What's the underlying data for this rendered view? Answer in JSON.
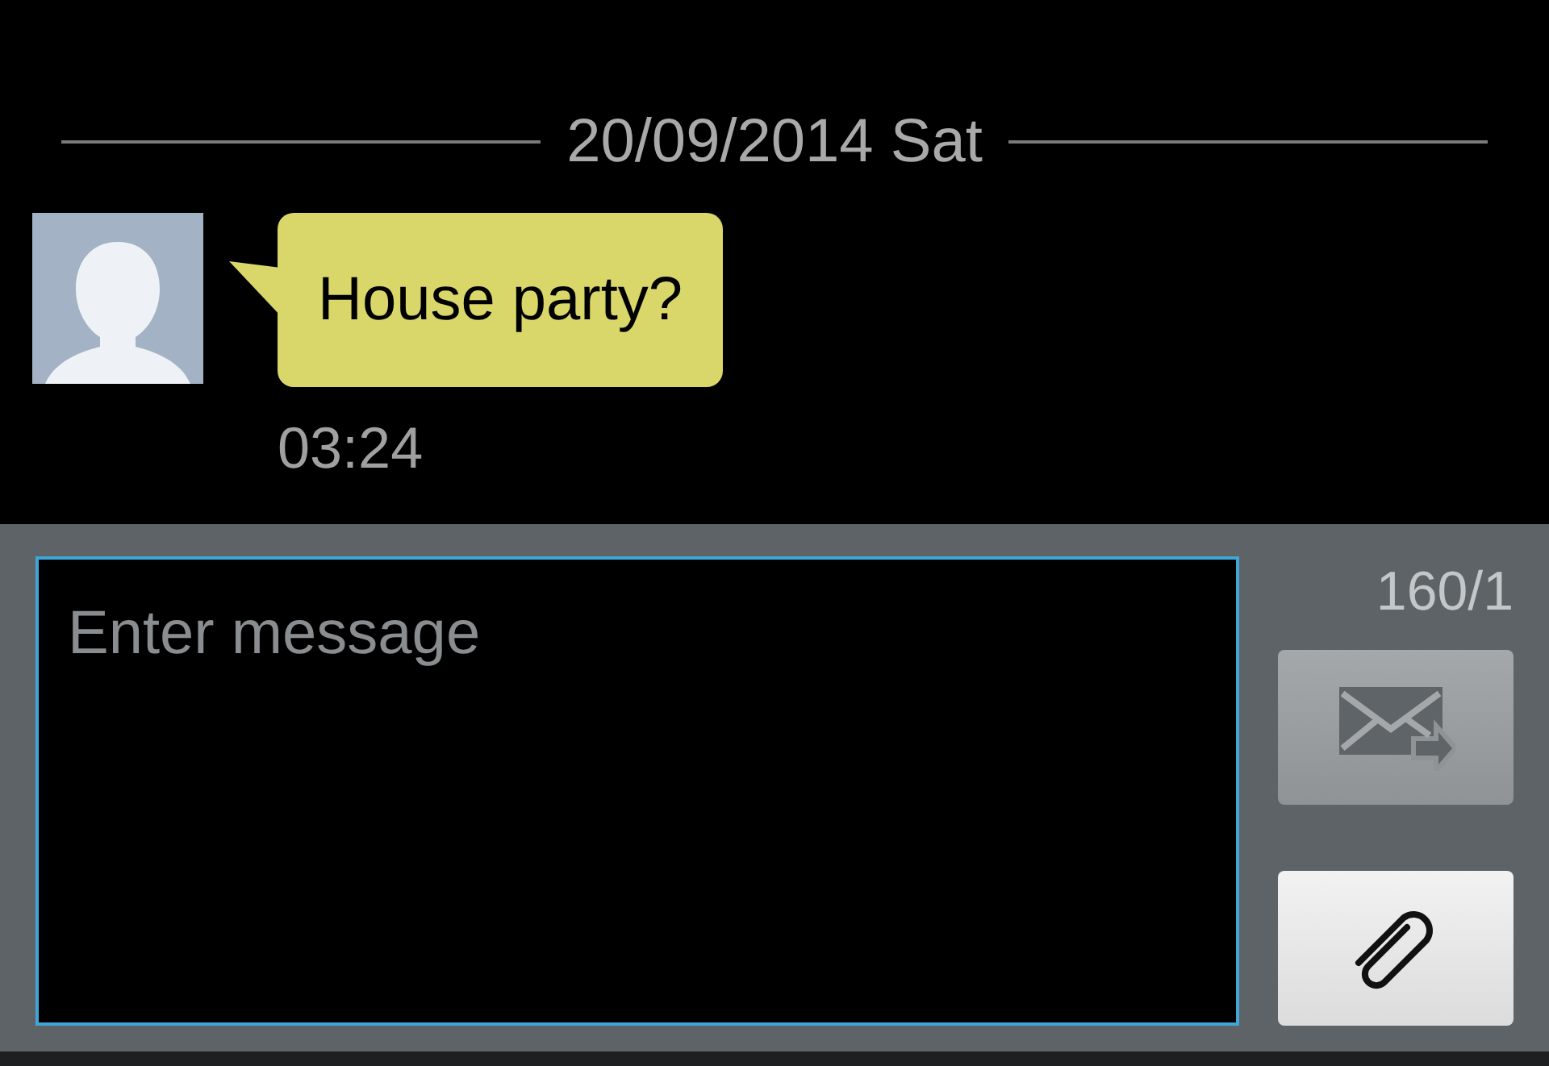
{
  "conversation": {
    "date_divider": "20/09/2014 Sat",
    "messages": [
      {
        "text": "House party?",
        "time": "03:24"
      }
    ]
  },
  "composer": {
    "placeholder": "Enter message",
    "counter": "160/1",
    "send_button": {
      "disabled": true
    }
  }
}
